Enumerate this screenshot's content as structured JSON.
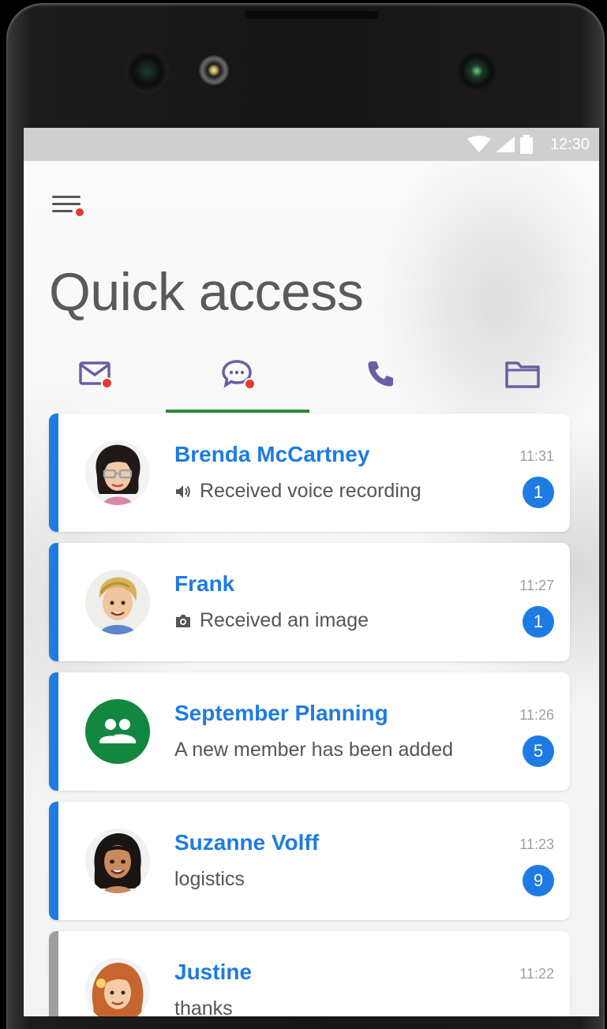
{
  "status_bar": {
    "time": "12:30"
  },
  "header": {
    "title": "Quick access"
  },
  "tabs": [
    {
      "name": "mail",
      "icon": "mail-icon",
      "has_notification": true
    },
    {
      "name": "chat",
      "icon": "chat-icon",
      "has_notification": true,
      "active": true
    },
    {
      "name": "phone",
      "icon": "phone-icon",
      "has_notification": false
    },
    {
      "name": "files",
      "icon": "folder-icon",
      "has_notification": false
    }
  ],
  "conversations": [
    {
      "name": "Brenda McCartney",
      "preview": "Received voice recording",
      "preview_icon": "speaker-icon",
      "time": "11:31",
      "unread": "1"
    },
    {
      "name": "Frank",
      "preview": "Received an image",
      "preview_icon": "camera-icon",
      "time": "11:27",
      "unread": "1"
    },
    {
      "name": "September Planning",
      "preview": "A new member has been added",
      "preview_icon": "",
      "time": "11:26",
      "unread": "5"
    },
    {
      "name": "Suzanne Volff",
      "preview": "logistics",
      "preview_icon": "",
      "time": "11:23",
      "unread": "9"
    },
    {
      "name": "Justine",
      "preview": "thanks",
      "preview_icon": "",
      "time": "11:22",
      "unread": ""
    }
  ],
  "colors": {
    "accent": "#1e7be3",
    "tab_underline": "#2e8b3a",
    "notification_dot": "#e53935",
    "group_avatar": "#12873f",
    "icon_purple": "#6a5fa0"
  }
}
